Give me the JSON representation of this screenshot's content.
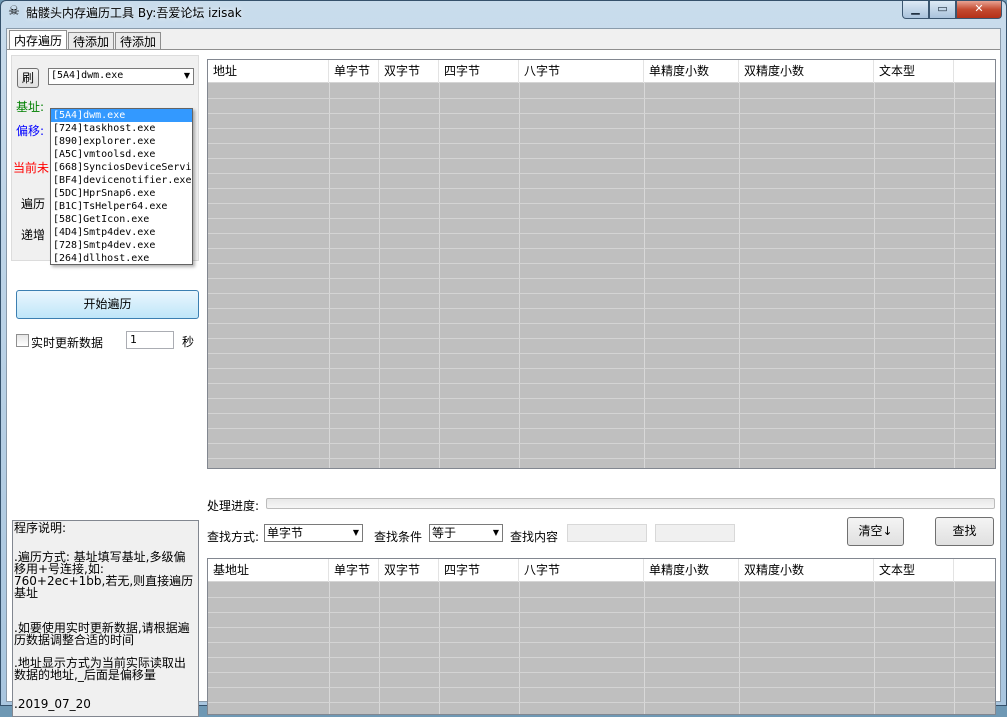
{
  "window": {
    "title": "骷髅头内存遍历工具 By:吾爱论坛 izisak",
    "min_icon": "minimize-icon",
    "max_icon": "maximize-icon",
    "close_icon": "close-icon",
    "close_glyph": "✕",
    "min_glyph": "▁",
    "max_glyph": "▭",
    "app_icon": "skull-icon"
  },
  "tabs": [
    "内存遍历",
    "待添加",
    "待添加"
  ],
  "left": {
    "refresh_label": "刷",
    "process_selected": "[5A4]dwm.exe",
    "process_list": [
      "[5A4]dwm.exe",
      "[724]taskhost.exe",
      "[890]explorer.exe",
      "[A5C]vmtoolsd.exe",
      "[668]SynciosDeviceService.exe",
      "[BF4]devicenotifier.exe",
      "[5DC]HprSnap6.exe",
      "[B1C]TsHelper64.exe",
      "[58C]GetIcon.exe",
      "[4D4]Smtp4dev.exe",
      "[728]Smtp4dev.exe",
      "[264]dllhost.exe"
    ],
    "base_label": "基址:",
    "offset_label": "偏移:",
    "current_label": "当前未",
    "traverse_label": "遍历",
    "increment_label": "递增",
    "start_button": "开始遍历",
    "realtime_label": "实时更新数据",
    "interval_value": "1",
    "seconds_label": "秒",
    "colors": {
      "base": "#008000",
      "offset": "#0000ff",
      "current": "#ff0000"
    }
  },
  "top_grid": {
    "columns": [
      "地址",
      "单字节",
      "双字节",
      "四字节",
      "八字节",
      "单精度小数",
      "双精度小数",
      "文本型"
    ]
  },
  "progress": {
    "label": "处理进度:",
    "value": 0
  },
  "search": {
    "method_label": "查找方式:",
    "method_value": "单字节",
    "condition_label": "查找条件",
    "condition_value": "等于",
    "content_label": "查找内容",
    "clear_button": "清空↓",
    "find_button": "查找"
  },
  "bottom_grid": {
    "columns": [
      "基地址",
      "单字节",
      "双字节",
      "四字节",
      "八字节",
      "单精度小数",
      "双精度小数",
      "文本型"
    ]
  },
  "description": {
    "title": "程序说明:",
    "lines": [
      ".遍历方式: 基址填写基址,多级偏移用+号连接,如: 760+2ec+1bb,若无,则直接遍历基址",
      ".如要使用实时更新数据,请根据遍历数据调整合适的时间",
      ".地址显示方式为当前实际读取出数据的地址,_后面是偏移量",
      ".2019_07_20"
    ]
  }
}
